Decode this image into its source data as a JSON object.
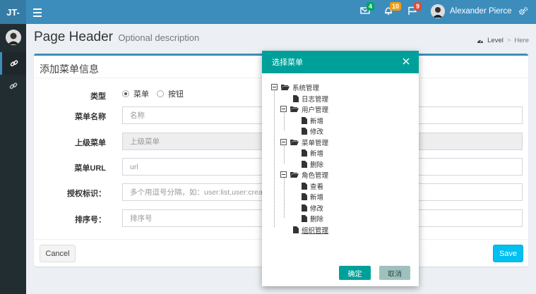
{
  "app": {
    "logo": "JT-"
  },
  "navbar": {
    "mail_badge": "4",
    "bell_badge": "10",
    "flag_badge": "9",
    "user_name": "Alexander Pierce",
    "colors": {
      "mail_badge": "#00a65a",
      "bell_badge": "#f39c12",
      "flag_badge": "#dd4b39"
    }
  },
  "header": {
    "title": "Page Header",
    "subtitle": "Optional description"
  },
  "breadcrumb": {
    "level": "Level",
    "separator": ">",
    "here": "Here"
  },
  "form": {
    "title": "添加菜单信息",
    "type_label": "类型",
    "type_options": [
      "菜单",
      "按钮"
    ],
    "name_label": "菜单名称",
    "name_placeholder": "名称",
    "parent_label": "上级菜单",
    "parent_placeholder": "上级菜单",
    "url_label": "菜单URL",
    "url_placeholder": "url",
    "perm_label": "授权标识：",
    "perm_placeholder": "多个用逗号分隔，如：user:list,user:creat",
    "sort_label": "排序号：",
    "sort_placeholder": "排序号",
    "cancel": "Cancel",
    "save": "Save"
  },
  "modal": {
    "title": "选择菜单",
    "tree": {
      "root": "系统管理",
      "log": "日志管理",
      "user": "用户管理",
      "user_children": [
        "新增",
        "修改"
      ],
      "menu": "菜单管理",
      "menu_children": [
        "新增",
        "删除"
      ],
      "role": "角色管理",
      "role_children": [
        "查看",
        "新增",
        "修改",
        "删除"
      ],
      "org": "组织管理"
    },
    "ok": "确定",
    "cancel": "取消"
  }
}
